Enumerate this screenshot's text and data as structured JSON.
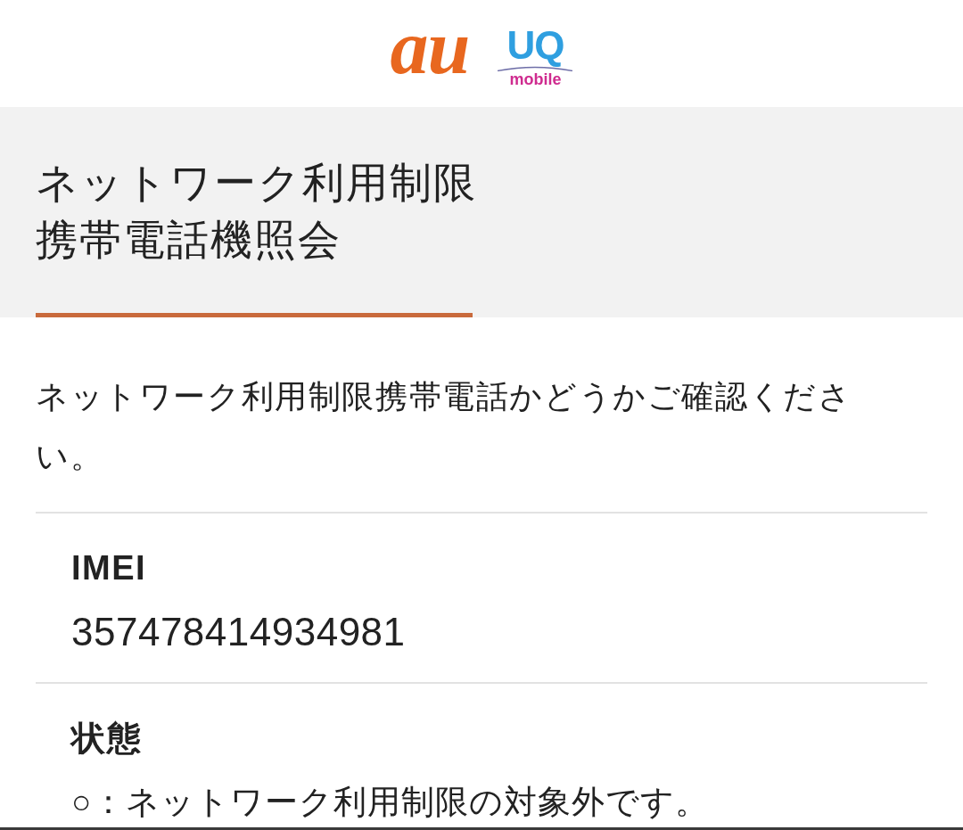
{
  "header": {
    "logos": [
      {
        "kind": "au",
        "text": "au"
      },
      {
        "kind": "uq",
        "text": "UQ",
        "subtext": "mobile"
      }
    ]
  },
  "page_title": {
    "lines": [
      "ネットワーク利用制限",
      "携帯電話機照会"
    ]
  },
  "description": "ネットワーク利用制限携帯電話かどうかご確認ください。",
  "results": [
    {
      "label": "IMEI",
      "value": "357478414934981"
    },
    {
      "label": "状態",
      "value": "○：ネットワーク利用制限の対象外です。"
    }
  ]
}
